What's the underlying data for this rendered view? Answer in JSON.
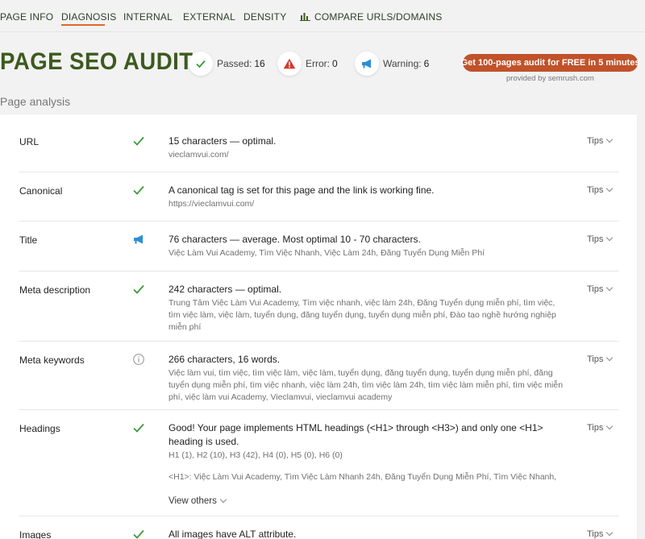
{
  "nav": {
    "items": [
      {
        "label": "PAGE INFO"
      },
      {
        "label": "DIAGNOSIS",
        "active": true
      },
      {
        "label": "INTERNAL"
      },
      {
        "label": "EXTERNAL"
      },
      {
        "label": "DENSITY"
      },
      {
        "label": "COMPARE URLS/DOMAINS",
        "icon": "bar-chart-icon"
      }
    ]
  },
  "header": {
    "title": "PAGE SEO AUDIT",
    "passed_label": "Passed:",
    "passed_count": "16",
    "error_label": "Error:",
    "error_count": "0",
    "warning_label": "Warning:",
    "warning_count": "6",
    "cta_label": "Get 100-pages audit for FREE in 5 minutes",
    "provided_by": "provided by  semrush.com"
  },
  "analysis": {
    "heading": "Page analysis",
    "tips_label": "Tips",
    "rows": [
      {
        "name": "URL",
        "status": "pass",
        "icon": "check-icon",
        "main": "15 characters — optimal.",
        "sub": "vieclamvui.com/"
      },
      {
        "name": "Canonical",
        "status": "pass",
        "icon": "check-icon",
        "main": "A canonical tag is set for this page and the link is working fine.",
        "sub": "https://vieclamvui.com/"
      },
      {
        "name": "Title",
        "status": "warning",
        "icon": "megaphone-icon",
        "main": "76 characters — average. Most optimal 10 - 70 characters.",
        "sub": "Việc Làm Vui Academy, Tìm Việc Nhanh, Việc Làm 24h, Đăng Tuyển Dụng Miễn Phí"
      },
      {
        "name": "Meta description",
        "status": "pass",
        "icon": "check-icon",
        "main": "242 characters — optimal.",
        "sub": "Trung Tâm Việc Làm Vui Academy, Tìm việc nhanh, việc làm 24h, Đăng Tuyển dụng miễn phí, tìm việc, tìm việc làm, việc làm, tuyển dụng, đăng tuyển dụng, tuyển dụng miễn phí, Đào tạo nghề hướng nghiệp miễn phí"
      },
      {
        "name": "Meta keywords",
        "status": "info",
        "icon": "info-icon",
        "main": "266 characters, 16 words.",
        "sub": "Việc làm vui, tìm việc, tìm việc làm, việc làm, tuyển dụng, đăng tuyển dụng, tuyển dụng miễn phí, đăng tuyển dụng miễn phí, tìm việc nhanh, việc làm 24h, tìm việc làm 24h, tìm việc làm miễn phí, tìm việc miễn phí, việc làm vui Academy, Vieclamvui, vieclamvui academy"
      },
      {
        "name": "Headings",
        "status": "pass",
        "icon": "check-icon",
        "main": "Good! Your page implements HTML headings (<H1> through <H3>) and only one <H1> heading is used.",
        "sub": "H1 (1), H2 (10), H3 (42), H4 (0), H5 (0), H6 (0)",
        "sub2": "<H1>: Việc Làm Vui Academy, Tìm Việc Làm Nhanh 24h, Đăng Tuyển Dụng Miễn Phí, Tìm Việc Nhanh,",
        "view_others": "View others"
      },
      {
        "name": "Images",
        "status": "pass",
        "icon": "check-icon",
        "main": "All images have ALT attribute."
      }
    ]
  },
  "colors": {
    "pass": "#3a9a3a",
    "error": "#d33b2c",
    "warning": "#2b8fd6",
    "accent": "#e0682c",
    "cta": "#c0522a",
    "title": "#3c5a1e"
  }
}
